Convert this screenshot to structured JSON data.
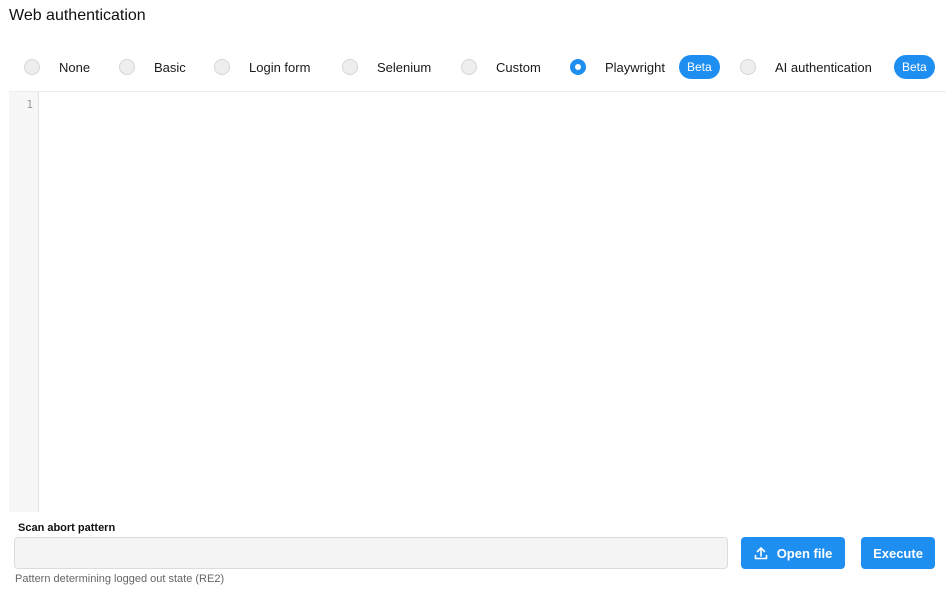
{
  "page": {
    "title": "Web authentication"
  },
  "auth_methods": {
    "selected": "Playwright",
    "options": [
      {
        "label": "None",
        "checked": false
      },
      {
        "label": "Basic",
        "checked": false
      },
      {
        "label": "Login form",
        "checked": false
      },
      {
        "label": "Selenium",
        "checked": false
      },
      {
        "label": "Custom",
        "checked": false
      },
      {
        "label": "Playwright",
        "checked": true,
        "badge": "Beta"
      },
      {
        "label": "AI authentication",
        "checked": false,
        "badge": "Beta"
      }
    ]
  },
  "editor": {
    "line_numbers": [
      "1"
    ],
    "content": ""
  },
  "scan_abort": {
    "label": "Scan abort pattern",
    "value": "",
    "help": "Pattern determining logged out state (RE2)"
  },
  "actions": {
    "open_file_label": "Open file",
    "execute_label": "Execute"
  },
  "colors": {
    "accent": "#1f8ef1"
  }
}
